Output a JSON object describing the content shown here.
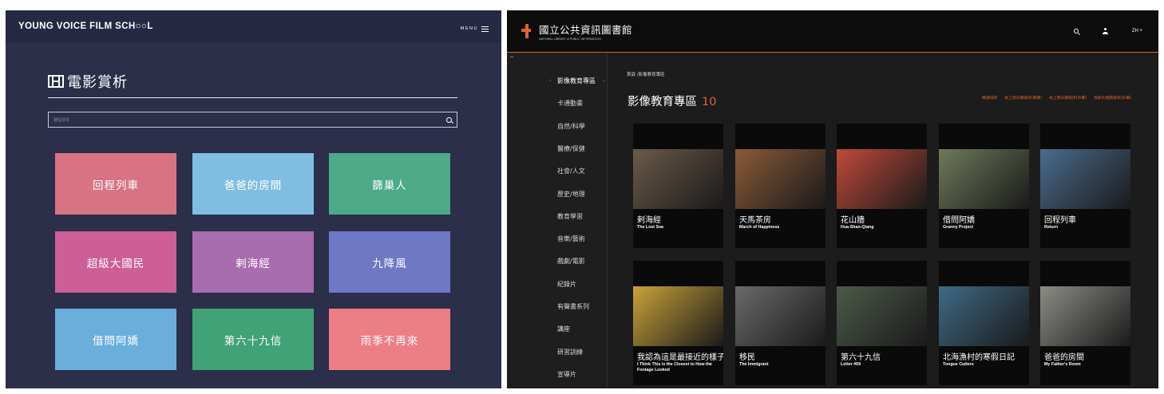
{
  "left": {
    "logo": "YOUNG VOICE FILM SCH○○L",
    "menu_label": "MENU",
    "title": "電影賞析",
    "search_placeholder": "課程搜尋",
    "tiles": [
      {
        "label": "回程列車",
        "color": "#d87383"
      },
      {
        "label": "爸爸的房間",
        "color": "#7fbde3"
      },
      {
        "label": "篩巢人",
        "color": "#4caa88"
      },
      {
        "label": "超級大國民",
        "color": "#cc5e98"
      },
      {
        "label": "剌海經",
        "color": "#a96cae"
      },
      {
        "label": "九降風",
        "color": "#6e78c4"
      },
      {
        "label": "借問阿嬌",
        "color": "#6aaedc"
      },
      {
        "label": "第六十九信",
        "color": "#42a277"
      },
      {
        "label": "雨季不再來",
        "color": "#ec7f85"
      }
    ]
  },
  "right": {
    "logo_title": "國立公共資訊圖書館",
    "logo_subtitle": "NATIONAL LIBRARY of PUBLIC INFORMATION",
    "lang": "ZH ˅",
    "accent": "#e0622a",
    "sidebar": [
      "影像教育專區",
      "卡通動畫",
      "自然/科學",
      "醫療/保健",
      "社會/人文",
      "歷史/地理",
      "教育學習",
      "音樂/藝術",
      "戲劇/電影",
      "紀錄片",
      "有聲書系列",
      "講座",
      "研習訓練",
      "宣導片"
    ],
    "breadcrumb": "首頁 /影像教育專區",
    "title": "影像教育專區",
    "count": "10",
    "sorts": [
      "精選排序",
      "依上架日期排序(降冪)",
      "依上架日期排序(升冪)",
      "依影片標題排序(升冪)"
    ],
    "cards": [
      {
        "zh": "剌海經",
        "en": "The Lost Sea",
        "color": "#6b5a4a"
      },
      {
        "zh": "天馬茶房",
        "en": "March of Happiness",
        "color": "#8a5b38"
      },
      {
        "zh": "花山牆",
        "en": "Hua-Shan-Qiang",
        "color": "#c04a3a"
      },
      {
        "zh": "借問阿嬌",
        "en": "Granny Project",
        "color": "#6e7a5a"
      },
      {
        "zh": "回程列車",
        "en": "Return",
        "color": "#4a6c8e"
      },
      {
        "zh": "我認為這是最接近的樣子",
        "en": "I Think This is the Closest to How the Footage Looked",
        "color": "#c9a23a"
      },
      {
        "zh": "移民",
        "en": "The Immigrant",
        "color": "#6a6a6a"
      },
      {
        "zh": "第六十九信",
        "en": "Letter #69",
        "color": "#4c5a4a"
      },
      {
        "zh": "北海漁村的寒假日記",
        "en": "Tongue Cutters",
        "color": "#3f6a86"
      },
      {
        "zh": "爸爸的房間",
        "en": "My Father's Room",
        "color": "#8c8c86"
      }
    ]
  }
}
